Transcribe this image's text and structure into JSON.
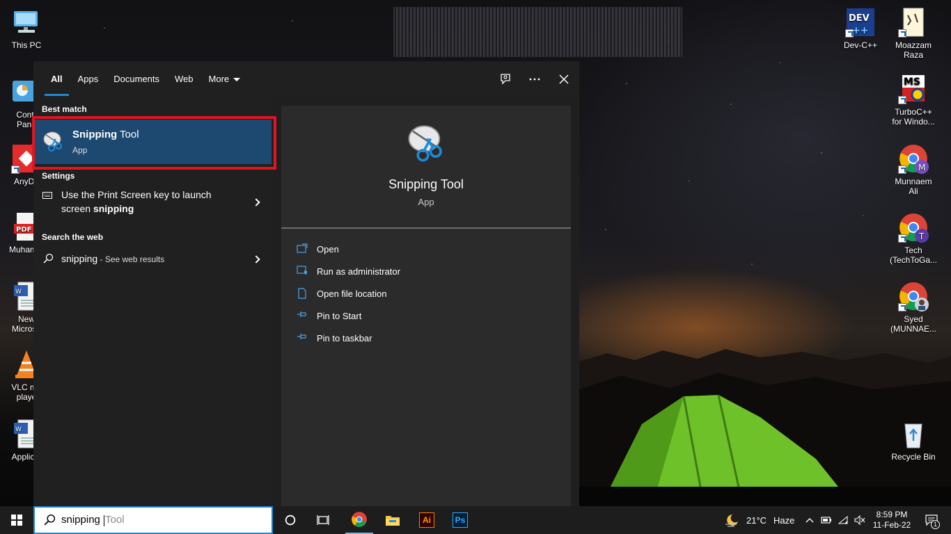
{
  "desktop": {
    "icons_left": [
      {
        "label": "This PC",
        "icon": "computer-icon"
      },
      {
        "label": "Contr\nPane",
        "icon": "control-panel-icon"
      },
      {
        "label": "AnyDe",
        "icon": "anydesk-icon"
      },
      {
        "label": "Muhamm",
        "icon": "pdf-icon"
      },
      {
        "label": "New\nMicroso",
        "icon": "word-doc-icon"
      },
      {
        "label": "VLC me\nplaye",
        "icon": "vlc-icon"
      },
      {
        "label": "Applicat",
        "icon": "word-doc-icon"
      }
    ],
    "icons_right": [
      {
        "label": "Dev-C++",
        "icon": "devcpp-icon",
        "badge_text": "DEV"
      },
      {
        "label": "Moazzam\nRaza",
        "icon": "text-file-icon"
      },
      {
        "label": "TurboC++\nfor Windo...",
        "icon": "turbocpp-icon",
        "badge_text": "MS"
      },
      {
        "label": "Munnaem\nAli",
        "icon": "chrome-profile-icon",
        "avatar_letter": "M",
        "avatar_color": "#7a4fc4"
      },
      {
        "label": "Tech\n(TechToGa...",
        "icon": "chrome-profile-icon",
        "avatar_letter": "T",
        "avatar_color": "#5b3aa8"
      },
      {
        "label": "Syed\n(MUNNAE...",
        "icon": "chrome-profile-icon",
        "avatar_letter": "",
        "avatar_color": "#c9d3dd"
      },
      {
        "label": "Recycle Bin",
        "icon": "recycle-bin-icon"
      }
    ]
  },
  "search_panel": {
    "tabs": [
      {
        "label": "All",
        "active": true
      },
      {
        "label": "Apps"
      },
      {
        "label": "Documents"
      },
      {
        "label": "Web"
      },
      {
        "label": "More",
        "dropdown": true
      }
    ],
    "best_match_heading": "Best match",
    "best_match": {
      "name_bold": "Snipping",
      "name_rest": " Tool",
      "type": "App"
    },
    "settings_heading": "Settings",
    "settings_item": {
      "line1": "Use the Print Screen key to launch",
      "line2_plain": "screen ",
      "line2_bold": "snipping"
    },
    "web_heading": "Search the web",
    "web_item": {
      "query": "snipping",
      "suffix": " - See web results"
    },
    "details": {
      "title": "Snipping Tool",
      "subtitle": "App",
      "actions": [
        {
          "label": "Open",
          "icon": "open-icon"
        },
        {
          "label": "Run as administrator",
          "icon": "admin-shield-icon"
        },
        {
          "label": "Open file location",
          "icon": "file-location-icon"
        },
        {
          "label": "Pin to Start",
          "icon": "pin-icon"
        },
        {
          "label": "Pin to taskbar",
          "icon": "pin-icon"
        }
      ]
    }
  },
  "taskbar": {
    "search_value": "snipping ",
    "search_suggestion": "Tool",
    "pinned": [
      {
        "name": "chrome",
        "icon": "chrome-icon"
      },
      {
        "name": "file-explorer",
        "icon": "folder-icon"
      },
      {
        "name": "illustrator",
        "icon": "illustrator-icon",
        "text": "Ai"
      },
      {
        "name": "photoshop",
        "icon": "photoshop-icon",
        "text": "Ps"
      }
    ],
    "weather_temp": "21°C",
    "weather_text": "Haze",
    "time": "8:59 PM",
    "date": "11-Feb-22",
    "notification_count": "1"
  },
  "colors": {
    "accent": "#1e8ad6",
    "selection": "#1d4870",
    "highlight_red": "#e3131f"
  }
}
